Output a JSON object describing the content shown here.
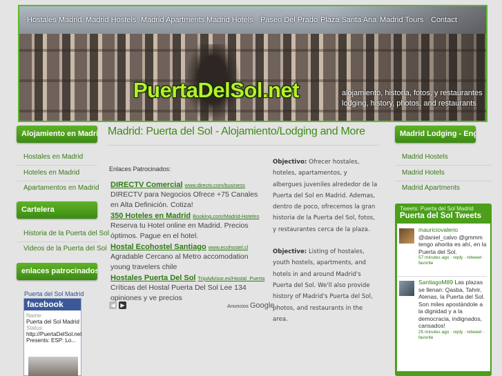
{
  "header": {
    "nav": [
      "Hostales Madrid",
      "Madrid Hostels",
      "Madrid Apartments",
      "Madrid Hotels",
      "Paseo Del Prado",
      "Plaza Santa Ana",
      "Madrid Tours",
      "Contact"
    ],
    "brand": "PuertaDelSol.net",
    "tagline_1": "alojamiento, historia, fotos, y restaurantes",
    "tagline_2": "lodging, history, photos, and restaurants"
  },
  "left_sidebar": {
    "section_1": "Alojamiento en Madrid",
    "links_1": [
      "Hostales en Madrid",
      "Hoteles en Madrid",
      "Apartamentos en Madrid"
    ],
    "section_2": "Cartelera",
    "links_2": [
      "Historia de la Puerta del Sol",
      "Videos de la Puerta del Sol"
    ],
    "section_3": "enlaces patrocinados",
    "facebook": {
      "title": "Puerta del Sol Madrid",
      "logo": "facebook",
      "name_label": "Name:",
      "name_value": "Puerta del Sol Madrid",
      "status_label": "Status:",
      "status_value": "http://PuertaDelSol.net Presents: ESP: Lo..."
    }
  },
  "main": {
    "title": "Madrid: Puerta del Sol - Alojamiento/Lodging and More",
    "ads_header": "Enlaces Patrocinados:",
    "ads": [
      {
        "title": "DIRECTV Comercial",
        "url": "www.directv.com/business",
        "text": "DIRECTV para Negocios Ofrece +75 Canales en Alta Definición. Cotiza!"
      },
      {
        "title": "350 Hoteles en Madrid",
        "url": "Booking.com/Madrid-Hoteles",
        "text": "Reserva tu Hotel online en Madrid. Precios óptimos. Pague en el hotel."
      },
      {
        "title": "Hostal Ecohostel Santiago",
        "url": "www.ecohostel.cl",
        "text": "Agradable Cercano al Metro accomodation young travelers chile"
      },
      {
        "title": "Hostales Puerta Del Sol",
        "url": "TripAdvisor.es/Hostal_Puerta",
        "text": "Críticas del Hostal Puerta Del Sol Lee 134 opiniones y ve precios"
      }
    ],
    "ads_by": "Anuncios",
    "ads_by_brand": "Google",
    "objetivo_label": "Objectivo:",
    "objetivo_text": "Ofrecer hostales, hoteles, apartamentos, y albergues juveniles alrededor de la Puerta del Sol en Madrid. Ademas, dentro de poco, ofrecemos la gran historia de la Puerta del Sol, fotos, y restaurantes cerca de la plaza.",
    "objective_label": "Objective:",
    "objective_text": "Listing of hostales, youth hostels, apartments, and hotels in and around Madrid's Puerta del Sol. We'll also provide history of Madrid's Puerta del Sol, photos, and restaurants in the area."
  },
  "right_sidebar": {
    "section_1": "Madrid Lodging - English",
    "links": [
      "Madrid Hostels",
      "Madrid Hotels",
      "Madrid Apartments"
    ],
    "twitter": {
      "label": "Tweets: Puerta del Sol Madrid",
      "name": "Puerta del Sol Tweets",
      "tweets": [
        {
          "user": "mauriciovalerio",
          "text": "@daniel_calvo @gmmm tengo ahorita es ahí, en la Puerta del Sol.",
          "meta": "57 minutes ago · reply · retweet · favorite"
        },
        {
          "user": "SantiagoM89",
          "text": "Las plazas se llenan: Qasba, Tahrir, Atenas, la Puerta del Sol. Son miles apostándole a la dignidad y a la democracia, indignados, cansados!",
          "meta": "25 minutes ago · reply · retweet · favorite"
        }
      ]
    }
  },
  "colors": {
    "accent": "#3d8c16",
    "header_bar": "#5fb325",
    "brand_text": "#b7f02a"
  }
}
